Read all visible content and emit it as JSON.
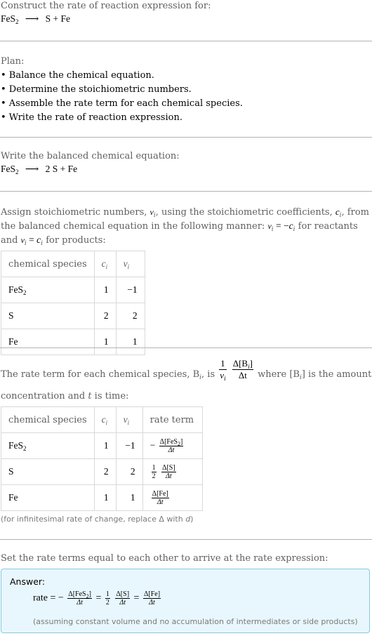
{
  "intro": {
    "heading": "Construct the rate of reaction expression for:",
    "reaction": {
      "reactant": "FeS",
      "reactant_sub": "2",
      "arrow": "⟶",
      "products": "S + Fe"
    }
  },
  "plan": {
    "heading": "Plan:",
    "steps": [
      "• Balance the chemical equation.",
      "• Determine the stoichiometric numbers.",
      "• Assemble the rate term for each chemical species.",
      "• Write the rate of reaction expression."
    ]
  },
  "balanced": {
    "heading": "Write the balanced chemical equation:",
    "reactant": "FeS",
    "reactant_sub": "2",
    "arrow": "⟶",
    "products": "2 S + Fe"
  },
  "stoich": {
    "line1_a": "Assign stoichiometric numbers, ",
    "nu": "ν",
    "i": "i",
    "line1_b": ", using the stoichiometric coefficients, ",
    "c": "c",
    "line1_c": ", from",
    "line2_a": "the balanced chemical equation in the following manner: ",
    "eq_react": " = −",
    "line2_b": " for reactants",
    "line3_a": "and ",
    "eq_prod": " = ",
    "line3_b": " for products:",
    "table": {
      "headers": [
        "chemical species",
        "c",
        "ν"
      ],
      "rows": [
        {
          "species": "FeS",
          "sub": "2",
          "c": "1",
          "nu": "−1"
        },
        {
          "species": "S",
          "sub": "",
          "c": "2",
          "nu": "2"
        },
        {
          "species": "Fe",
          "sub": "",
          "c": "1",
          "nu": "1"
        }
      ]
    }
  },
  "rate_term": {
    "text_a": "The rate term for each chemical species, B",
    "text_b": ", is ",
    "frac1_num": "1",
    "frac2_num": "Δ[B",
    "frac2_den": "Δt",
    "text_c": " where [B",
    "text_d": "] is the amount",
    "line2": "concentration and ",
    "t": "t",
    "line2_b": " is time:",
    "table": {
      "headers": [
        "chemical species",
        "c",
        "ν",
        "rate term"
      ],
      "rows": [
        {
          "species": "FeS",
          "sub": "2",
          "c": "1",
          "nu": "−1",
          "sign": "−",
          "coef": "",
          "num": "Δ[FeS",
          "num_sub": "2",
          "num_end": "]",
          "den": "Δt"
        },
        {
          "species": "S",
          "sub": "",
          "c": "2",
          "nu": "2",
          "sign": "",
          "coef_num": "1",
          "coef_den": "2",
          "num": "Δ[S]",
          "num_sub": "",
          "num_end": "",
          "den": "Δt"
        },
        {
          "species": "Fe",
          "sub": "",
          "c": "1",
          "nu": "1",
          "sign": "",
          "coef": "",
          "num": "Δ[Fe]",
          "num_sub": "",
          "num_end": "",
          "den": "Δt"
        }
      ]
    },
    "note_a": "(for infinitesimal rate of change, replace Δ with ",
    "note_d": "d",
    "note_b": ")"
  },
  "final": {
    "heading": "Set the rate terms equal to each other to arrive at the rate expression:",
    "answer_label": "Answer:",
    "rate": "rate",
    "eq": " = ",
    "minus": "−",
    "t1_num": "Δ[FeS",
    "t1_sub": "2",
    "t1_end": "]",
    "den": "Δt",
    "c_num": "1",
    "c_den": "2",
    "t2_num": "Δ[S]",
    "t3_num": "Δ[Fe]",
    "note": "(assuming constant volume and no accumulation of intermediates or side products)"
  },
  "colors": {
    "answer_bg": "#e8f7fd",
    "answer_border": "#86c9df",
    "separator": "#b3b3b3",
    "muted_text": "#5f5f5f"
  }
}
